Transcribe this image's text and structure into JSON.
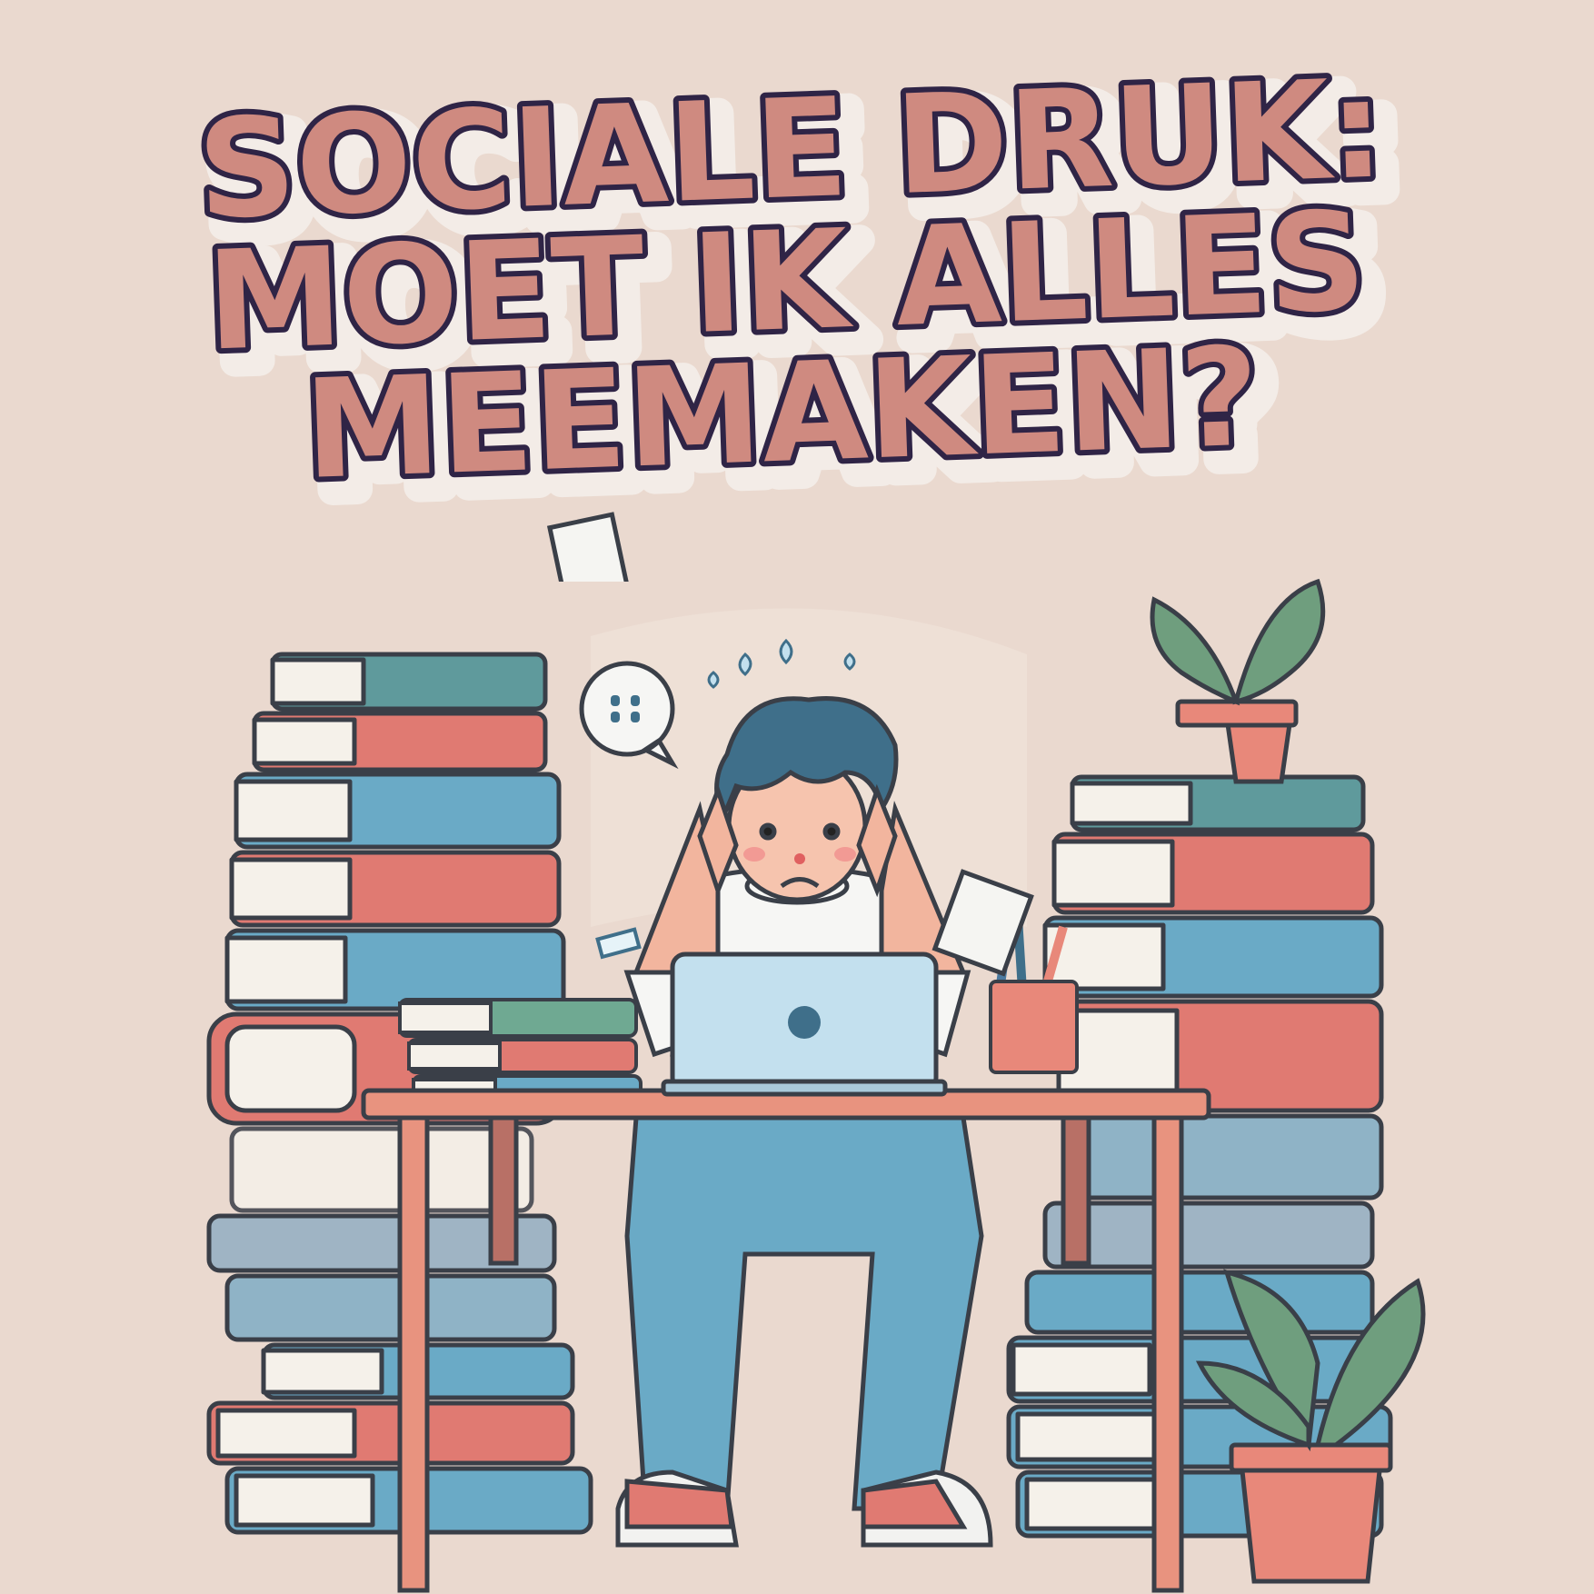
{
  "title": {
    "lines": [
      "SOCIALE DRUK:",
      "MOET IK ALLES",
      "MEEMAKEN?"
    ]
  },
  "colors": {
    "background": "#ead9cf",
    "title_fill": "#cf8a80",
    "title_outline": "#2f2446",
    "title_shadow": "#f4eee9",
    "book_teal": "#5f9a9c",
    "book_blue": "#6aaac6",
    "book_red": "#e07a72",
    "hair": "#3f6f8a",
    "laptop": "#c3e0ee",
    "plant": "#6f9e7e",
    "pot": "#e8887a"
  },
  "icons": {
    "speech_bubble": "speech-bubble-icon",
    "sweat_drops": "sweat-drops-icon",
    "laptop_logo": "laptop-logo-icon"
  }
}
